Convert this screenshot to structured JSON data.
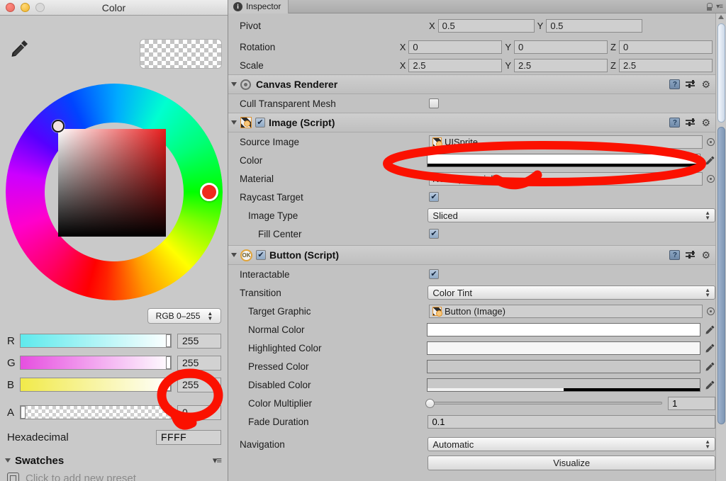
{
  "color_window": {
    "title": "Color",
    "eyedropper_icon": "eyedropper-icon",
    "mode": "RGB 0–255",
    "sliders": [
      {
        "label": "R",
        "value": "255"
      },
      {
        "label": "G",
        "value": "255"
      },
      {
        "label": "B",
        "value": "255"
      },
      {
        "label": "A",
        "value": "0"
      }
    ],
    "hex_label": "Hexadecimal",
    "hex_value": "FFFF",
    "swatches_label": "Swatches",
    "preset_text": "Click to add new preset"
  },
  "inspector": {
    "tab_label": "Inspector",
    "transform": {
      "pivot": {
        "label": "Pivot",
        "x_axis": "X",
        "x": "0.5",
        "y_axis": "Y",
        "y": "0.5"
      },
      "rotation": {
        "label": "Rotation",
        "x_axis": "X",
        "x": "0",
        "y_axis": "Y",
        "y": "0",
        "z_axis": "Z",
        "z": "0"
      },
      "scale": {
        "label": "Scale",
        "x_axis": "X",
        "x": "2.5",
        "y_axis": "Y",
        "y": "2.5",
        "z_axis": "Z",
        "z": "2.5"
      }
    },
    "canvas_renderer": {
      "title": "Canvas Renderer",
      "cull_label": "Cull Transparent Mesh"
    },
    "image_script": {
      "title": "Image (Script)",
      "source_image_label": "Source Image",
      "source_image_value": "UISprite",
      "color_label": "Color",
      "material_label": "Material",
      "material_value": "None (Material)",
      "raycast_label": "Raycast Target",
      "image_type_label": "Image Type",
      "image_type_value": "Sliced",
      "fill_center_label": "Fill Center"
    },
    "button_script": {
      "title": "Button (Script)",
      "badge": "OK",
      "interactable_label": "Interactable",
      "transition_label": "Transition",
      "transition_value": "Color Tint",
      "target_graphic_label": "Target Graphic",
      "target_graphic_value": "Button (Image)",
      "normal_color_label": "Normal Color",
      "highlighted_color_label": "Highlighted Color",
      "pressed_color_label": "Pressed Color",
      "disabled_color_label": "Disabled Color",
      "color_multiplier_label": "Color Multiplier",
      "color_multiplier_value": "1",
      "fade_duration_label": "Fade Duration",
      "fade_duration_value": "0.1",
      "navigation_label": "Navigation",
      "navigation_value": "Automatic",
      "visualize_label": "Visualize"
    }
  },
  "annotations": {
    "accent_color": "#fb1100",
    "ellipse_target": "image-color-swatch",
    "circle_target": "alpha-value-field"
  }
}
